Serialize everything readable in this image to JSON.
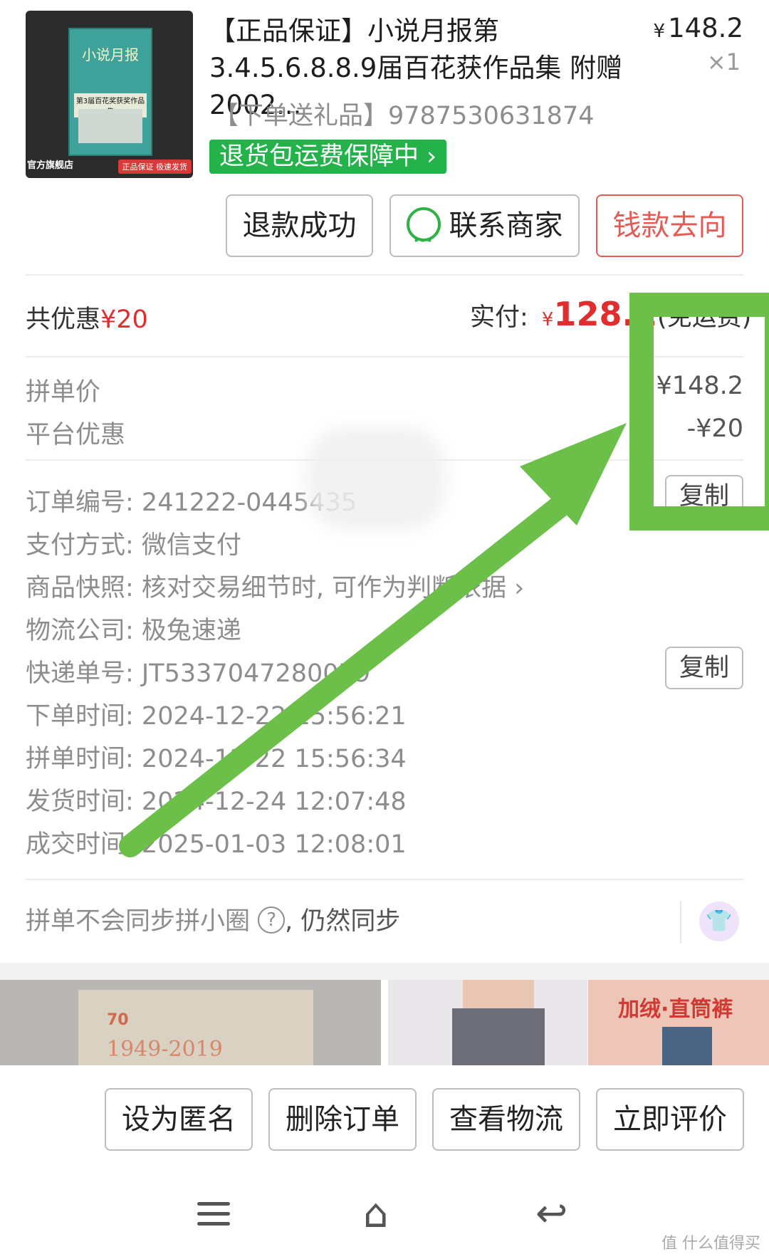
{
  "product": {
    "thumb": {
      "book_title": "小说月报",
      "book_subtitle": "第3届百花奖获奖作品集",
      "store_name": "官方旗舰店",
      "store_tag": "正品保证 极速发货"
    },
    "title": "【正品保证】小说月报第3.4.5.6.8.8.9届百花获作品集 附赠2002...",
    "price_currency": "¥",
    "price": "148.2",
    "quantity": "×1",
    "spec": "【下单送礼品】9787530631874",
    "return_badge": "退货包运费保障中 ›"
  },
  "actions": {
    "refund": "退款成功",
    "contact": "联系商家",
    "money_flow": "钱款去向"
  },
  "summary": {
    "discount_label": "共优惠",
    "discount_value": "¥20",
    "paid_label": "实付: ",
    "paid_currency": "¥",
    "paid_amount": "128.2",
    "paid_note": "(免运费)"
  },
  "price_detail": [
    {
      "label": "拼单价",
      "value": "¥148.2"
    },
    {
      "label": "平台优惠",
      "value": "-¥20"
    }
  ],
  "order_info": [
    {
      "label": "订单编号: ",
      "value": "241222-0445435"
    },
    {
      "label": "支付方式: ",
      "value": "微信支付"
    },
    {
      "label": "商品快照: ",
      "value": "核对交易细节时, 可作为判断依据 ›"
    },
    {
      "label": "物流公司: ",
      "value": "极兔速递"
    },
    {
      "label": "快递单号: ",
      "value": "JT5337047280079"
    },
    {
      "label": "下单时间: ",
      "value": "2024-12-22 15:56:21"
    },
    {
      "label": "拼单时间: ",
      "value": "2024-12-22 15:56:34"
    },
    {
      "label": "发货时间: ",
      "value": "2024-12-24 12:07:48"
    },
    {
      "label": "成交时间: ",
      "value": "2025-01-03 12:08:01"
    }
  ],
  "copy_label": "复制",
  "sync": {
    "text": "拼单不会同步拼小圈",
    "help": "?",
    "strong": ", 仍然同步"
  },
  "ads": {
    "ad1_badge": "70",
    "ad1_years": "1949-2019",
    "ad3_slogan": "加绒·直筒裤"
  },
  "bottom_actions": [
    "设为匿名",
    "删除订单",
    "查看物流",
    "立即评价"
  ],
  "navbar": {
    "home_glyph": "⌂",
    "back_glyph": "↩"
  },
  "watermark": "值 什么值得买",
  "annotation": {
    "color": "#6cc04a"
  }
}
